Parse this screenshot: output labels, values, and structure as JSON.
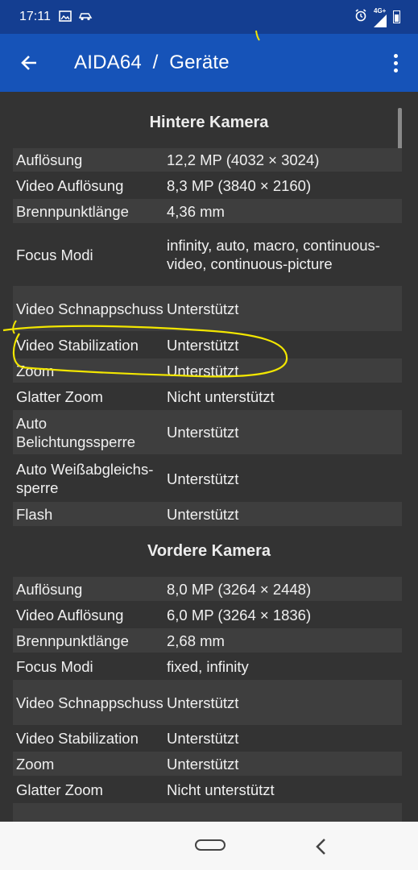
{
  "status_bar": {
    "time": "17:11",
    "network": "4G+"
  },
  "app_bar": {
    "title": "AIDA64  /  Geräte"
  },
  "sections": [
    {
      "title": "Hintere Kamera",
      "rows": [
        {
          "label": "Auflösung",
          "value": "12,2 MP (4032 × 3024)"
        },
        {
          "label": "Video Auflösung",
          "value": "8,3 MP (3840 × 2160)"
        },
        {
          "label": "Brennpunktlänge",
          "value": "4,36 mm"
        },
        {
          "label": "Focus Modi",
          "value": "infinity, auto, macro, continuous-video, continuous-picture"
        },
        {
          "label": "Video Schnappschuss",
          "value": "Unterstützt"
        },
        {
          "label": "Video Stabilization",
          "value": "Unterstützt"
        },
        {
          "label": "Zoom",
          "value": "Unterstützt"
        },
        {
          "label": "Glatter Zoom",
          "value": "Nicht unterstützt"
        },
        {
          "label": "Auto Belichtungssperre",
          "value": "Unterstützt"
        },
        {
          "label": "Auto Weißabgleichs-sperre",
          "value": "Unterstützt"
        },
        {
          "label": "Flash",
          "value": "Unterstützt"
        }
      ]
    },
    {
      "title": "Vordere Kamera",
      "rows": [
        {
          "label": "Auflösung",
          "value": "8,0 MP (3264 × 2448)"
        },
        {
          "label": "Video Auflösung",
          "value": "6,0 MP (3264 × 1836)"
        },
        {
          "label": "Brennpunktlänge",
          "value": "2,68 mm"
        },
        {
          "label": "Focus Modi",
          "value": "fixed, infinity"
        },
        {
          "label": "Video Schnappschuss",
          "value": "Unterstützt"
        },
        {
          "label": "Video Stabilization",
          "value": "Unterstützt"
        },
        {
          "label": "Zoom",
          "value": "Unterstützt"
        },
        {
          "label": "Glatter Zoom",
          "value": "Nicht unterstützt"
        }
      ]
    }
  ],
  "colors": {
    "status_bar": "#143e91",
    "app_bar": "#1653b8",
    "background": "#333333",
    "row_alt": "#3e3e3e",
    "annotation": "#f2e600"
  },
  "icons": [
    "image-icon",
    "car-icon",
    "alarm-icon",
    "signal-icon",
    "battery-icon",
    "back-arrow-icon",
    "overflow-menu-icon",
    "home-pill-icon",
    "nav-back-icon"
  ]
}
